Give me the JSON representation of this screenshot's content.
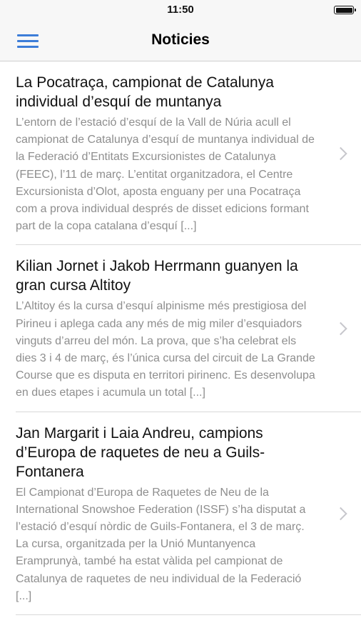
{
  "status_bar": {
    "time": "11:50"
  },
  "nav": {
    "title": "Noticies",
    "menu_icon": "hamburger-menu-icon"
  },
  "news": [
    {
      "title": "La Pocatraça, campionat de Catalunya individual d’esquí de muntanya",
      "excerpt": "L’entorn de l’estació d’esquí de la Vall de Núria acull el campionat de Catalunya d’esquí de muntanya individual de la Federació d’Entitats Excursionistes de Catalunya (FEEC), l’11 de març. L’entitat organitzadora, el Centre Excursionista d’Olot, aposta enguany per una Pocatraça com a prova individual després de disset edicions formant part de la copa catalana d’esquí [...]"
    },
    {
      "title": "Kilian Jornet i Jakob Herrmann guanyen la gran cursa Altitoy",
      "excerpt": "L’Altitoy és la cursa d’esquí alpinisme més prestigiosa del Pirineu i aplega cada any més de mig miler d’esquiadors vinguts d’arreu del món. La prova, que s’ha celebrat els dies 3 i 4 de març, és l’única cursa del circuit de La Grande Course que es disputa en territori pirinenc. Es desenvolupa en dues etapes i acumula un total [...]"
    },
    {
      "title": "Jan Margarit i Laia Andreu, campions d’Europa de raquetes de neu a Guils-Fontanera",
      "excerpt": "El Campionat d’Europa de Raquetes de Neu de la International Snowshoe Federation (ISSF) s’ha disputat a l’estació d’esquí nòrdic de Guils-Fontanera, el 3 de març. La cursa, organitzada per la Unió Muntanyenca Eramprunyà, també ha estat vàlida pel campionat de Catalunya de raquetes de neu individual de la Federació [...]"
    }
  ]
}
